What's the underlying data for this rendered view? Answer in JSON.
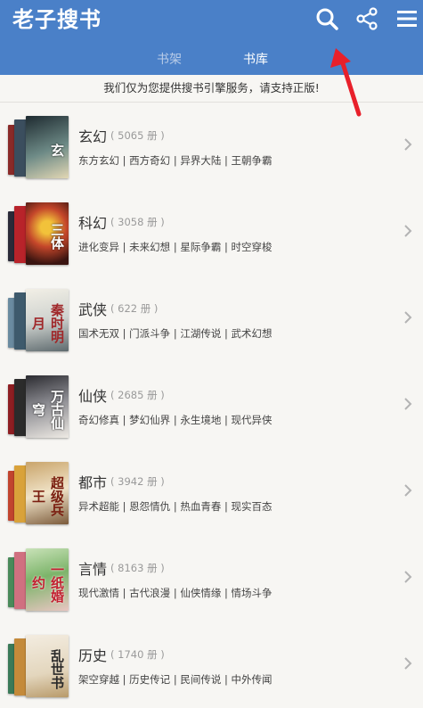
{
  "header": {
    "title": "老子搜书",
    "background": "#4a80c8",
    "icons": [
      "search-icon",
      "share-icon",
      "menu-icon"
    ]
  },
  "tabs": [
    {
      "label": "书架",
      "active": false
    },
    {
      "label": "书库",
      "active": true
    }
  ],
  "notice": "我们仅为您提供搜书引擎服务，请支持正版!",
  "categories": [
    {
      "name": "玄幻",
      "count": "( 5065 册 )",
      "tags": "东方玄幻 | 西方奇幻 | 异界大陆 | 王朝争霸",
      "cover_text": "玄"
    },
    {
      "name": "科幻",
      "count": "( 3058 册 )",
      "tags": "进化变异 | 未来幻想 | 星际争霸 | 时空穿梭",
      "cover_text": "三体"
    },
    {
      "name": "武侠",
      "count": "( 622 册 )",
      "tags": "国术无双 | 门派斗争 | 江湖传说 | 武术幻想",
      "cover_text": "秦时明月"
    },
    {
      "name": "仙侠",
      "count": "( 2685 册 )",
      "tags": "奇幻修真 | 梦幻仙界 | 永生境地 | 现代异侠",
      "cover_text": "万古仙穹"
    },
    {
      "name": "都市",
      "count": "( 3942 册 )",
      "tags": "异术超能 | 恩怨情仇 | 热血青春 | 现实百态",
      "cover_text": "超级兵王"
    },
    {
      "name": "言情",
      "count": "( 8163 册 )",
      "tags": "现代激情 | 古代浪漫 | 仙侠情缘 | 情场斗争",
      "cover_text": "一纸婚约"
    },
    {
      "name": "历史",
      "count": "( 1740 册 )",
      "tags": "架空穿越 | 历史传记 | 民间传说 | 中外传闻",
      "cover_text": "乱世书"
    }
  ]
}
